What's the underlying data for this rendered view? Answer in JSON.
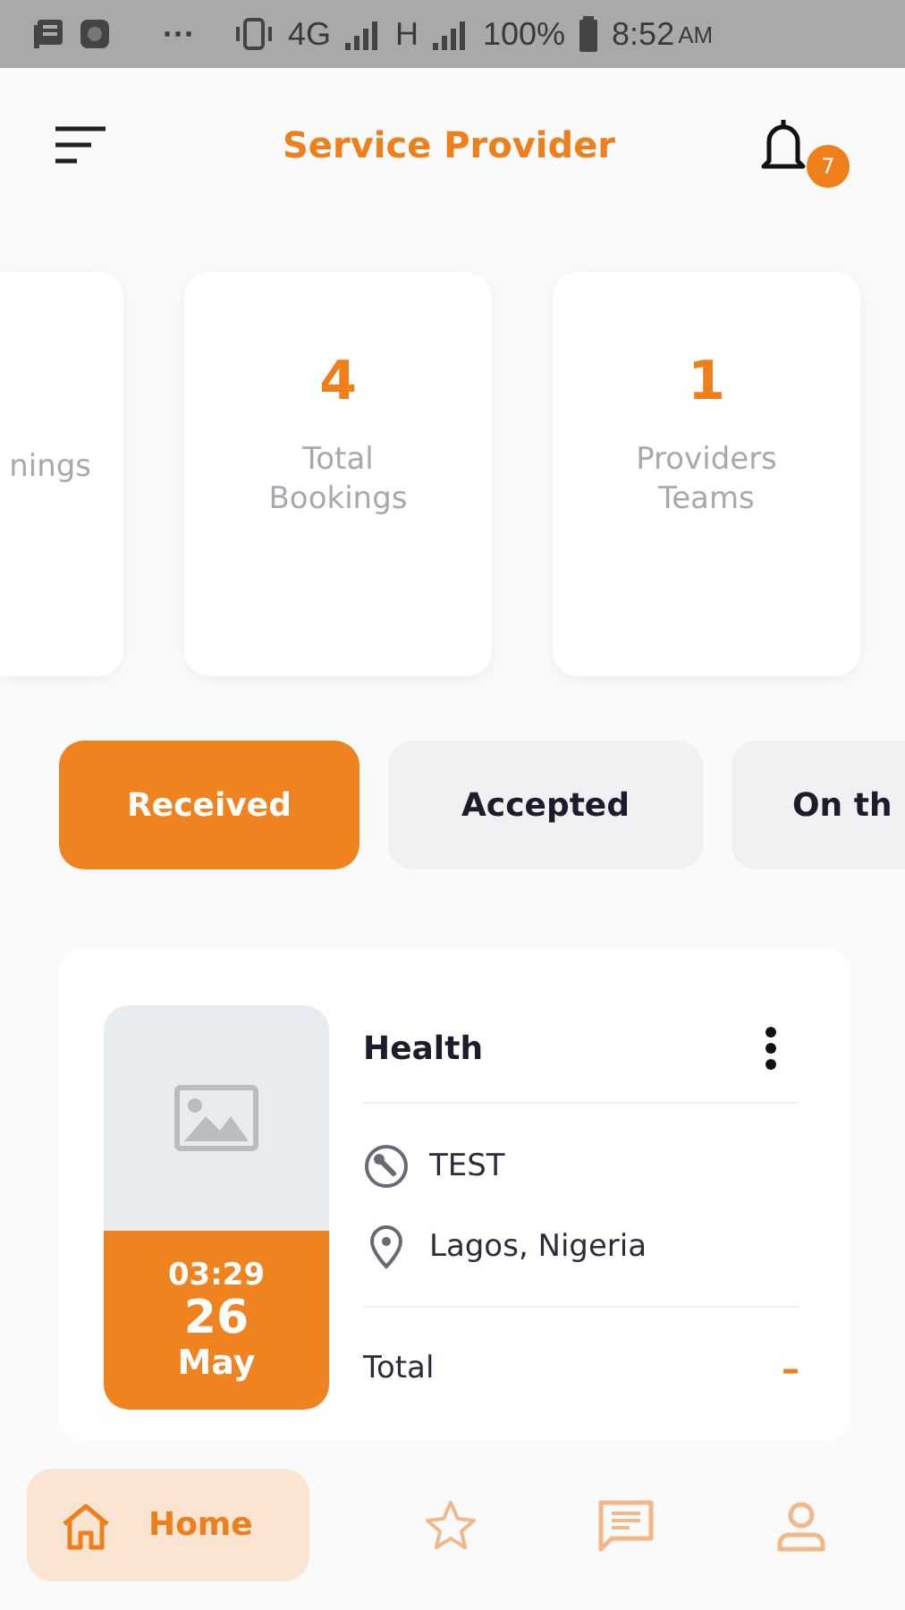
{
  "status_bar": {
    "dots": "···",
    "network": "4G",
    "network2": "H",
    "battery": "100%",
    "time": "8:52",
    "ampm": "AM"
  },
  "header": {
    "title": "Service Provider",
    "notification_count": "7"
  },
  "stats": [
    {
      "label": "nings"
    },
    {
      "value": "4",
      "label": "Total Bookings"
    },
    {
      "value": "1",
      "label": "Providers Teams"
    }
  ],
  "tabs": [
    {
      "label": "Received",
      "selected": true
    },
    {
      "label": "Accepted",
      "selected": false
    },
    {
      "label": "On th",
      "selected": false
    }
  ],
  "booking": {
    "time": "03:29",
    "day": "26",
    "month": "May",
    "title": "Health",
    "service": "TEST",
    "location": "Lagos, Nigeria",
    "total_label": "Total",
    "total_value": "–"
  },
  "nav": [
    {
      "kind": "home",
      "label": "Home",
      "selected": true
    },
    {
      "kind": "star",
      "selected": false
    },
    {
      "kind": "chat",
      "selected": false
    },
    {
      "kind": "user",
      "selected": false
    }
  ]
}
